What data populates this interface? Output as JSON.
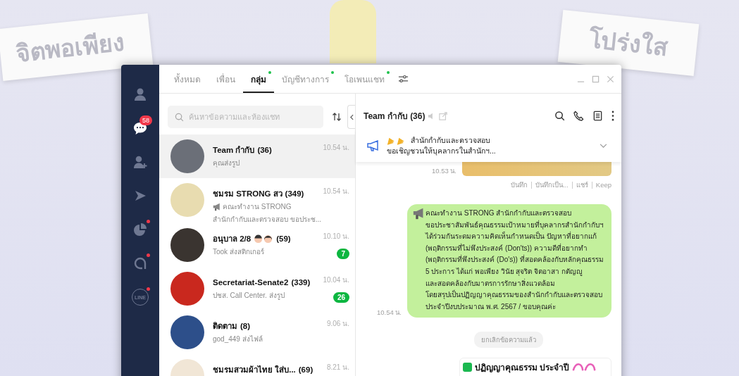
{
  "wallpaper": {
    "banners": [
      {
        "text": "จิตพอเพียง"
      },
      {
        "text": "โปร่งใส"
      }
    ]
  },
  "sidebar": {
    "items": [
      {
        "kind": "profile",
        "selected": false,
        "notification": false
      },
      {
        "kind": "chats",
        "selected": true,
        "notification": false,
        "badge": "58"
      },
      {
        "kind": "add-friend",
        "selected": false,
        "notification": false
      },
      {
        "kind": "play",
        "selected": false,
        "notification": false
      },
      {
        "kind": "pie",
        "selected": false,
        "notification": true
      },
      {
        "kind": "openchat",
        "selected": false,
        "notification": true
      },
      {
        "kind": "line",
        "selected": false,
        "notification": true,
        "label": "LINE"
      }
    ]
  },
  "tabs": [
    {
      "label": "ทั้งหมด",
      "selected": false,
      "new": false
    },
    {
      "label": "เพื่อน",
      "selected": false,
      "new": false
    },
    {
      "label": "กลุ่ม",
      "selected": true,
      "new": true
    },
    {
      "label": "บัญชีทางการ",
      "selected": false,
      "new": true
    },
    {
      "label": "โอเพนแชท",
      "selected": false,
      "new": true
    }
  ],
  "search": {
    "placeholder": "ค้นหาข้อความและห้องแชท"
  },
  "chats": [
    {
      "name": "Team กำกับ",
      "members": "(36)",
      "faces": false,
      "preview": [
        "คุณส่งรูป"
      ],
      "preview_icon": false,
      "time": "10.54 น.",
      "selected": true,
      "color": "#6b6f78"
    },
    {
      "name": "ชมรม STRONG สว",
      "members": "(349)",
      "faces": false,
      "preview": [
        "คณะทำงาน STRONG",
        "สำนักกำกับและตรวจสอบ ขอประช..."
      ],
      "preview_icon": true,
      "time": "10.54 น.",
      "selected": false,
      "color": "#e8dcb0"
    },
    {
      "name": "อนุบาล 2/8",
      "members": "(59)",
      "faces": true,
      "preview": [
        "Took ส่งสติกเกอร์"
      ],
      "preview_icon": false,
      "time": "10.10 น.",
      "unread": "7",
      "selected": false,
      "color": "#3a3430"
    },
    {
      "name": "Secretariat-Senate2",
      "members": "(339)",
      "faces": false,
      "preview": [
        "ปชส. Call Center. ส่งรูป"
      ],
      "preview_icon": false,
      "time": "10.04 น.",
      "unread": "26",
      "selected": false,
      "color": "#c9281e"
    },
    {
      "name": "ติดตาม",
      "members": "(8)",
      "faces": false,
      "preview": [
        "god_449 ส่งไฟล์"
      ],
      "preview_icon": false,
      "time": "9.06 น.",
      "selected": false,
      "color": "#2d4f8a"
    },
    {
      "name": "ชมรมสวมผ้าไทย ใส่บ...",
      "members": "(69)",
      "faces": false,
      "time": "8.21 น.",
      "selected": false,
      "color": "#f1e6d6"
    }
  ],
  "chat": {
    "title": "Team กำกับ (36)",
    "announcement": {
      "lines": [
        "สำนักกำกับและตรวจสอบ",
        "ขอเชิญชวนให้บุคลากรในสำนักฯ..."
      ]
    },
    "messages": [
      {
        "kind": "image",
        "time": "10.53 น.",
        "actions": [
          "บันทึก",
          "บันทึกเป็น...",
          "แชร์",
          "Keep"
        ]
      },
      {
        "kind": "text",
        "time": "10.54 น.",
        "text": "คณะทำงาน STRONG สำนักกำกับและตรวจสอบ\nขอประชาสัมพันธ์คุณธรรมเป้าหมายที่บุคลากรสำนักกำกับฯ\nได้ร่วมกันระดมความคิดเห็นกำหนดเป็น ปัญหาที่อยากแก้\n(พฤติกรรมที่ไม่พึงประสงค์ (Don'ts)) ความดีที่อยากทำ\n(พฤติกรรมที่พึงประสงค์ (Do's)) ที่สอดคล้องกับหลักคุณธรรม\n5 ประการ ได้แก่ พอเพียง วินัย สุจริต จิตอาสา กตัญญู\nและสอดคล้องกับมาตรการรักษาสิ่งแวดล้อม\nโดยสรุปเป็นปฏิญญาคุณธรรมของสำนักกำกับและตรวจสอบ\nประจำปีงบประมาณ พ.ศ. 2567 / ขอบคุณค่ะ"
      },
      {
        "kind": "notice",
        "text": "ยกเลิกข้อความแล้ว"
      },
      {
        "kind": "card",
        "text": "ปฏิญญาคุณธรรม ประจำปี"
      }
    ]
  }
}
